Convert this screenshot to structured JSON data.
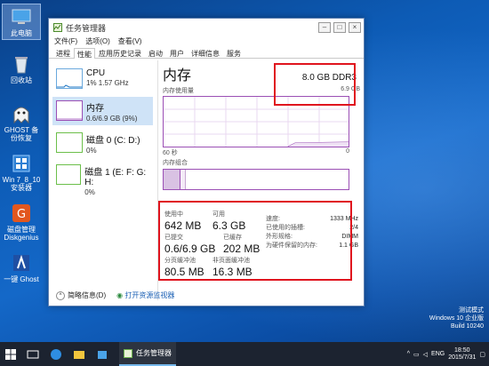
{
  "desktop": {
    "icons": [
      {
        "label": "此电脑"
      },
      {
        "label": "回收站"
      },
      {
        "label": "GHOST 备份恢复"
      },
      {
        "label": "Win 7_8_10 安装器"
      },
      {
        "label": "磁盘管理 Diskgenius"
      },
      {
        "label": "一键 Ghost"
      }
    ]
  },
  "window": {
    "title": "任务管理器",
    "menu": [
      "文件(F)",
      "选项(O)",
      "查看(V)"
    ],
    "tabs": [
      "进程",
      "性能",
      "应用历史记录",
      "启动",
      "用户",
      "详细信息",
      "服务"
    ],
    "active_tab": "性能"
  },
  "left_list": [
    {
      "title": "CPU",
      "sub": "1% 1.57 GHz"
    },
    {
      "title": "内存",
      "sub": "0.6/6.9 GB (9%)"
    },
    {
      "title": "磁盘 0 (C: D:)",
      "sub": "0%"
    },
    {
      "title": "磁盘 1 (E: F: G: H:",
      "sub": "0%"
    }
  ],
  "memory": {
    "title": "内存",
    "spec": "8.0 GB DDR3",
    "usage_label": "内存使用量",
    "usage_max": "6.9 GB",
    "scale_left": "60 秒",
    "scale_right": "0",
    "composition_label": "内存组合",
    "used_fraction": 0.09
  },
  "stats": {
    "in_use_label": "使用中",
    "in_use": "642 MB",
    "available_label": "可用",
    "available": "6.3 GB",
    "committed_label": "已提交",
    "committed": "0.6/6.9 GB",
    "cached_label": "已缓存",
    "cached": "202 MB",
    "paged_label": "分页缓冲池",
    "paged": "80.5 MB",
    "nonpaged_label": "非页面缓冲池",
    "nonpaged": "16.3 MB",
    "speed_label": "速度:",
    "speed": "1333 MHz",
    "slots_label": "已使用的插槽:",
    "slots": "2/4",
    "form_label": "外形规格:",
    "form": "DIMM",
    "reserved_label": "为硬件保留的内存:",
    "reserved": "1.1 GB"
  },
  "footer": {
    "less_details": "简略信息(D)",
    "open_monitor": "打开资源监视器"
  },
  "taskbar": {
    "app_label": "任务管理器",
    "lang": "ENG",
    "time": "18:50",
    "date": "2015/7/31"
  },
  "watermark": {
    "line1": "测试模式",
    "line2": "Windows 10 企业版",
    "line3": "Build 10240"
  },
  "colors": {
    "highlight": "#e0141e",
    "memory_purple": "#9b4fb5",
    "taskbar": "#1c2330"
  }
}
